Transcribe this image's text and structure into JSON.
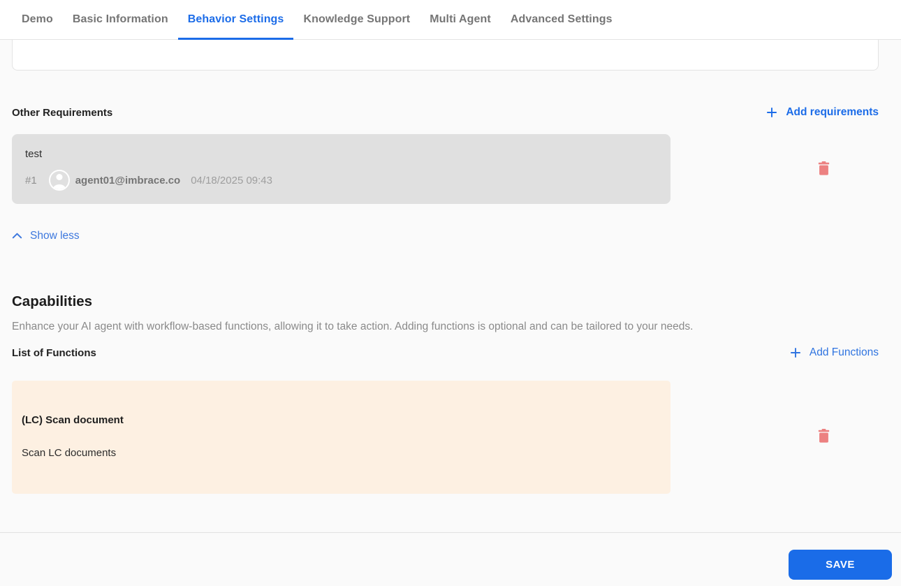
{
  "tabs": {
    "items": [
      {
        "label": "Demo",
        "active": false
      },
      {
        "label": "Basic Information",
        "active": false
      },
      {
        "label": "Behavior Settings",
        "active": true
      },
      {
        "label": "Knowledge Support",
        "active": false
      },
      {
        "label": "Multi Agent",
        "active": false
      },
      {
        "label": "Advanced Settings",
        "active": false
      }
    ]
  },
  "requirements_input": {
    "value": ""
  },
  "other_requirements": {
    "title": "Other Requirements",
    "add_label": "Add requirements",
    "items": [
      {
        "text": "test",
        "index": "#1",
        "author": "agent01@imbrace.co",
        "timestamp": "04/18/2025 09:43"
      }
    ],
    "show_less_label": "Show less"
  },
  "capabilities": {
    "title": "Capabilities",
    "description": "Enhance your AI agent with workflow-based functions, allowing it to take action. Adding functions is optional and can be tailored to your needs.",
    "list_title": "List of Functions",
    "add_label": "Add Functions",
    "functions": [
      {
        "name": "(LC) Scan document",
        "description": "Scan LC documents"
      }
    ]
  },
  "footer": {
    "save_label": "SAVE"
  },
  "icons": {
    "add": "plus-icon",
    "delete": "trash-icon",
    "collapse": "chevron-up-icon",
    "user": "person-avatar-icon"
  },
  "colors": {
    "accent_blue": "#1c6ce8",
    "link_blue_light": "#3d78de",
    "delete_red": "#ec8181",
    "requirement_card_bg": "#e0e0e0",
    "function_card_bg": "#fdf0e2",
    "inactive_tab_gray": "#757575",
    "page_bg": "#fafafa"
  }
}
